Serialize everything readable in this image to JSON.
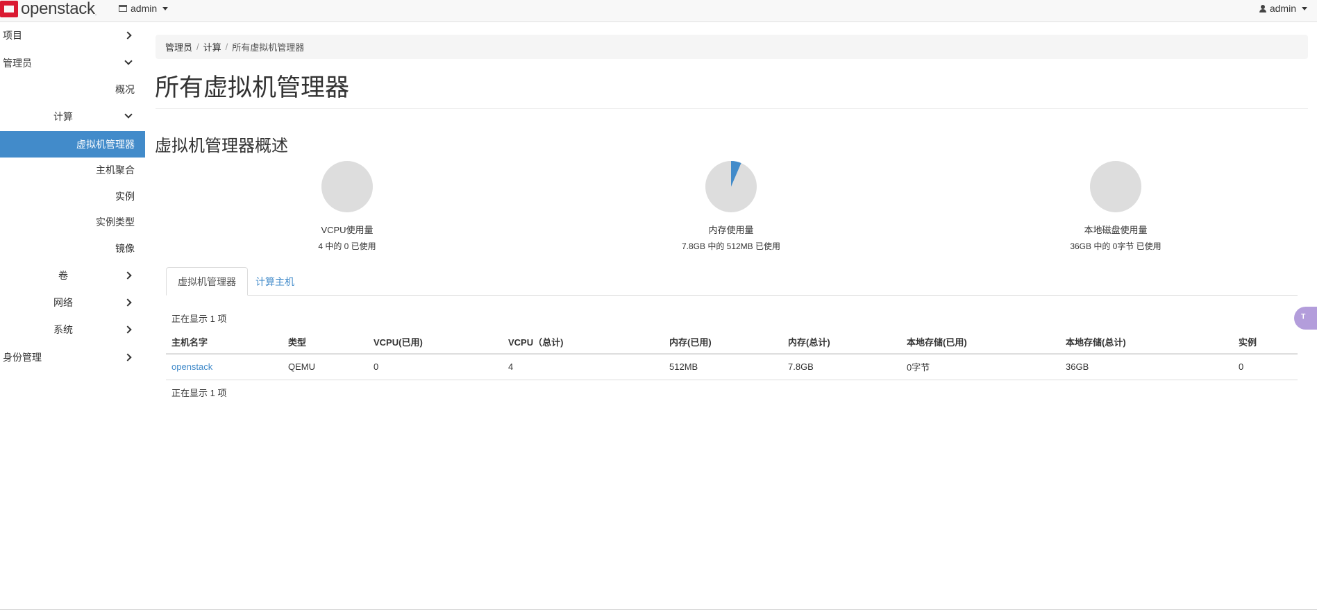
{
  "navbar": {
    "brand": "openstack",
    "brand_mark": ".",
    "project": "admin",
    "user": "admin"
  },
  "sidebar": {
    "items": [
      {
        "label": "项目"
      },
      {
        "label": "管理员"
      },
      {
        "label": "概况"
      },
      {
        "label": "计算"
      },
      {
        "label": "虚拟机管理器"
      },
      {
        "label": "主机聚合"
      },
      {
        "label": "实例"
      },
      {
        "label": "实例类型"
      },
      {
        "label": "镜像"
      },
      {
        "label": "卷"
      },
      {
        "label": "网络"
      },
      {
        "label": "系统"
      },
      {
        "label": "身份管理"
      }
    ]
  },
  "breadcrumb": [
    "管理员",
    "计算",
    "所有虚拟机管理器"
  ],
  "page_title": "所有虚拟机管理器",
  "summary": {
    "title": "虚拟机管理器概述",
    "charts": [
      {
        "label": "VCPU使用量",
        "detail": "4 中的 0 已使用",
        "used_fraction": 0
      },
      {
        "label": "内存使用量",
        "detail": "7.8GB 中的 512MB 已使用",
        "used_fraction": 0.0641
      },
      {
        "label": "本地磁盘使用量",
        "detail": "36GB 中的 0字节 已使用",
        "used_fraction": 0
      }
    ],
    "colors": {
      "used": "#428bca",
      "free": "#dddddd"
    }
  },
  "tabs": {
    "active": "虚拟机管理器",
    "other": "计算主机"
  },
  "table": {
    "count_top": "正在显示 1 项",
    "count_bottom": "正在显示 1 项",
    "columns": [
      "主机名字",
      "类型",
      "VCPU(已用)",
      "VCPU（总计)",
      "内存(已用)",
      "内存(总计)",
      "本地存储(已用)",
      "本地存储(总计)",
      "实例"
    ],
    "rows": [
      [
        "openstack",
        "QEMU",
        "0",
        "4",
        "512MB",
        "7.8GB",
        "0字节",
        "36GB",
        "0"
      ]
    ]
  },
  "widget": {
    "glyph": "ᵀ"
  }
}
